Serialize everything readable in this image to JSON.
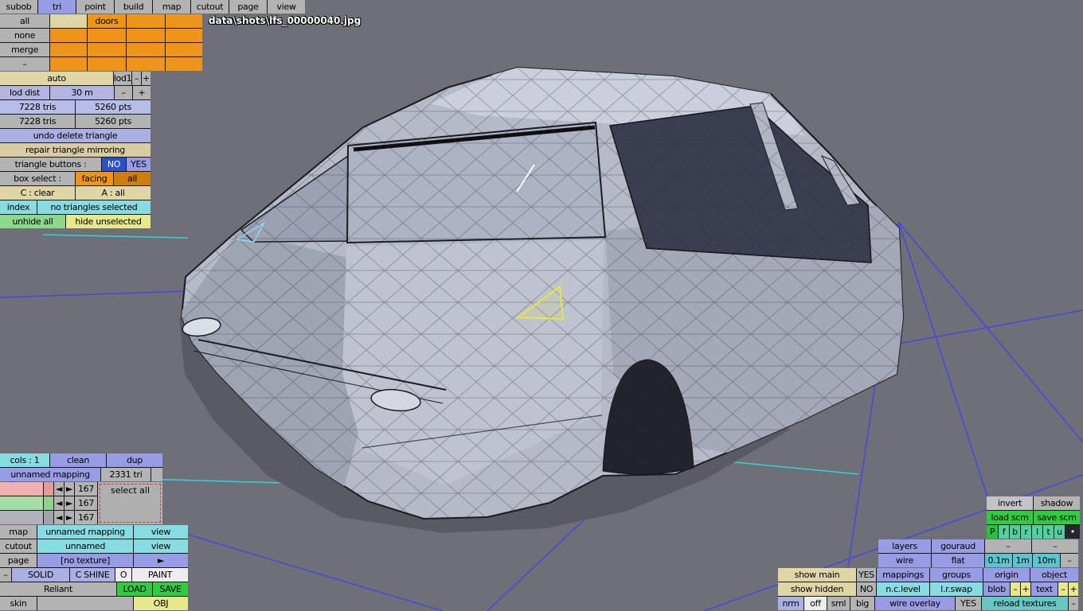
{
  "menubar": {
    "items": [
      "subob",
      "tri",
      "point",
      "build",
      "map",
      "cutout",
      "page",
      "view"
    ]
  },
  "viewport": {
    "filename": "data\\shots\\lfs_00000040.jpg",
    "background_color": "#6f6f78",
    "grid_color": "#4646e8",
    "measure_color": "#2ad8d8",
    "highlight_triangle_color": "#e8e83a",
    "marker_color": "#8ad8ee"
  },
  "subob_panel": {
    "buttons": [
      "all",
      "none",
      "merge",
      "–"
    ],
    "doors_label": "doors"
  },
  "lod_panel": {
    "auto": "auto",
    "lod1": "lod1",
    "minus": "–",
    "plus": "+",
    "dist_label": "lod dist",
    "dist_value": "30 m",
    "stats_selected": {
      "tris": "7228 tris",
      "pts": "5260 pts"
    },
    "stats_total": {
      "tris": "7228 tris",
      "pts": "5260 pts"
    }
  },
  "tri_panel": {
    "undo": "undo delete triangle",
    "repair": "repair triangle mirroring",
    "triangle_buttons_label": "triangle buttons :",
    "no": "NO",
    "yes": "YES",
    "box_select_label": "box select :",
    "facing": "facing",
    "all": "all",
    "c_clear": "C : clear",
    "a_all": "A : all",
    "index": "index",
    "selection_status": "no triangles selected",
    "unhide_all": "unhide all",
    "hide_unselected": "hide unselected"
  },
  "mapping_panel": {
    "cols": "cols : 1",
    "clean": "clean",
    "dup": "dup",
    "mapping_name": "unnamed mapping",
    "tri_count": "2331 tri",
    "prev": "◄",
    "next": "►",
    "swatch_rows": [
      {
        "count": "167"
      },
      {
        "count": "167"
      },
      {
        "count": "167"
      }
    ],
    "select_all": "select all",
    "map_label": "map",
    "map_value": "unnamed mapping",
    "map_view": "view",
    "cutout_label": "cutout",
    "cutout_value": "unnamed",
    "cutout_view": "view",
    "page_label": "page",
    "page_value": "[no texture]",
    "page_next": "►",
    "minus": "–",
    "solid": "SOLID",
    "c_shine": "C SHINE",
    "o": "O",
    "paint": "PAINT",
    "object_name": "Reliant",
    "load": "LOAD",
    "save": "SAVE",
    "skin_label": "skin",
    "skin_value": "",
    "obj": "OBJ"
  },
  "right_panel": {
    "invert": "invert",
    "shadow": "shadow",
    "load_scm": "load scm",
    "save_scm": "save scm",
    "small_buttons": [
      "P",
      "f",
      "b",
      "r",
      "l",
      "t",
      "u",
      "•"
    ],
    "layers": "layers",
    "gouraud": "gouraud",
    "dash": "–",
    "wire": "wire",
    "flat": "flat",
    "grid_01m": "0.1m",
    "grid_1m": "1m",
    "grid_10m": "10m",
    "mappings": "mappings",
    "groups": "groups",
    "origin": "origin",
    "object": "object",
    "show_main_label": "show main",
    "show_main_value": "YES",
    "show_hidden_label": "show hidden",
    "show_hidden_value": "NO",
    "nc_level": "n.c.level",
    "lr_swap": "l.r.swap",
    "blob": "blob",
    "text": "text",
    "small_minus": "–",
    "small_plus": "+",
    "nrm": "nrm",
    "off": "off",
    "sml": "sml",
    "big": "big",
    "wire_overlay_label": "wire overlay",
    "wire_overlay_value": "YES",
    "reload_textures": "reload textures"
  }
}
